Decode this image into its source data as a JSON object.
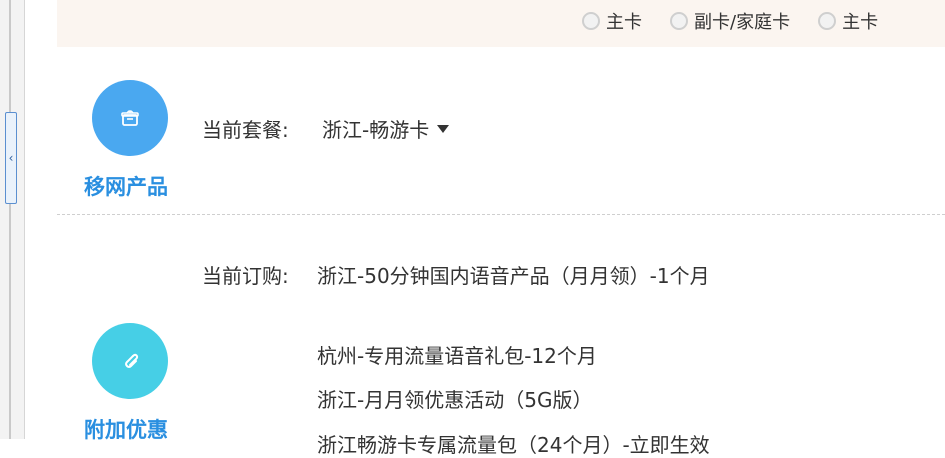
{
  "card_type": {
    "options": [
      "主卡",
      "副卡/家庭卡",
      "主卡"
    ]
  },
  "portability": {
    "title": "移网产品",
    "icon": "gift-icon",
    "current_plan_label": "当前套餐:",
    "current_plan_value": "浙江-畅游卡"
  },
  "addon": {
    "title": "附加优惠",
    "icon": "paperclip-icon",
    "current_order_label": "当前订购:",
    "current_order_value": "浙江-50分钟国内语音产品（月月领）-1个月",
    "items": [
      "杭州-专用流量语音礼包-12个月",
      "浙江-月月领优惠活动（5G版）",
      "浙江畅游卡专属流量包（24个月）-立即生效"
    ]
  },
  "colors": {
    "accent_blue": "#4aa8f0",
    "accent_cyan": "#46cfe6",
    "title_blue": "#2a8fe0",
    "header_bg": "#fbf5f0"
  }
}
